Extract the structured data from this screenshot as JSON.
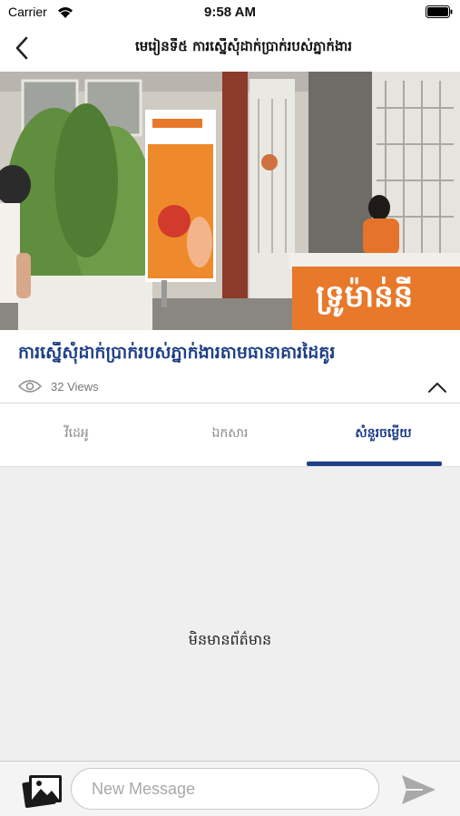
{
  "status_bar": {
    "carrier": "Carrier",
    "time": "9:58 AM"
  },
  "nav": {
    "title": "មេរៀនទី៥ ការស្នើសុំដាក់ប្រាក់របស់ភ្នាក់ងារ"
  },
  "video": {
    "sign_text": "ទ្រូម៉ាន់នី",
    "accent_color": "#e8782a"
  },
  "lesson": {
    "title": "ការស្នើសុំដាក់ប្រាក់របស់ភ្នាក់ងារតាមធានាគារដៃគូរ",
    "views": "32 Views"
  },
  "tabs": [
    {
      "label": "វីដេអូ",
      "active": false
    },
    {
      "label": "ឯកសារ",
      "active": false
    },
    {
      "label": "សំនួរចម្លើយ",
      "active": true
    }
  ],
  "content": {
    "empty_text": "មិនមានព័ត៌មាន"
  },
  "composer": {
    "placeholder": "New Message"
  },
  "colors": {
    "primary": "#1f3f86",
    "background": "#efefef"
  }
}
